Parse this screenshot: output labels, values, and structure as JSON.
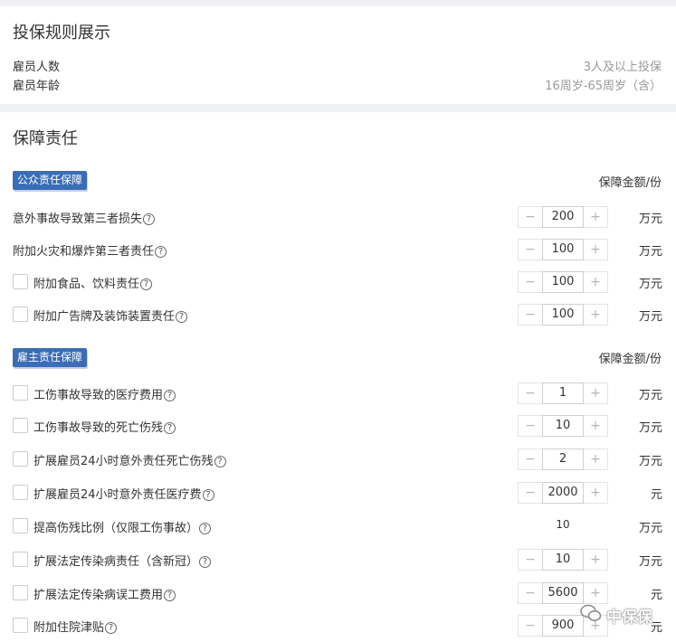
{
  "rules": {
    "title": "投保规则展示",
    "items": [
      {
        "label": "雇员人数",
        "value": "3人及以上投保"
      },
      {
        "label": "雇员年龄",
        "value": "16周岁-65周岁（含）"
      }
    ]
  },
  "coverage": {
    "title": "保障责任",
    "public": {
      "badge": "公众责任保障",
      "amount_header": "保障金额/份",
      "items": [
        {
          "label": "意外事故导致第三者损失",
          "value": "200",
          "unit": "万元"
        },
        {
          "label": "附加火灾和爆炸第三者责任",
          "value": "100",
          "unit": "万元"
        },
        {
          "label": "附加食品、饮料责任",
          "value": "100",
          "unit": "万元"
        },
        {
          "label": "附加广告牌及装饰装置责任",
          "value": "100",
          "unit": "万元"
        }
      ]
    },
    "employer": {
      "badge": "雇主责任保障",
      "amount_header": "保障金额/份",
      "items": [
        {
          "label": "工伤事故导致的医疗费用",
          "value": "1",
          "unit": "万元"
        },
        {
          "label": "工伤事故导致的死亡伤残",
          "value": "10",
          "unit": "万元"
        },
        {
          "label": "扩展雇员24小时意外责任死亡伤残",
          "value": "2",
          "unit": "万元"
        },
        {
          "label": "扩展雇员24小时意外责任医疗费",
          "value": "2000",
          "unit": "元"
        },
        {
          "label": "提高伤残比例（仅限工伤事故）",
          "value": "10",
          "unit": "万元"
        },
        {
          "label": "扩展法定传染病责任（含新冠）",
          "value": "10",
          "unit": "万元"
        },
        {
          "label": "扩展法定传染病误工费用",
          "value": "5600",
          "unit": "元"
        },
        {
          "label": "附加住院津贴",
          "value": "900",
          "unit": "元"
        }
      ]
    }
  },
  "stepper": {
    "minus": "−",
    "plus": "+"
  },
  "help_icon": "?",
  "watermark": "中保保"
}
